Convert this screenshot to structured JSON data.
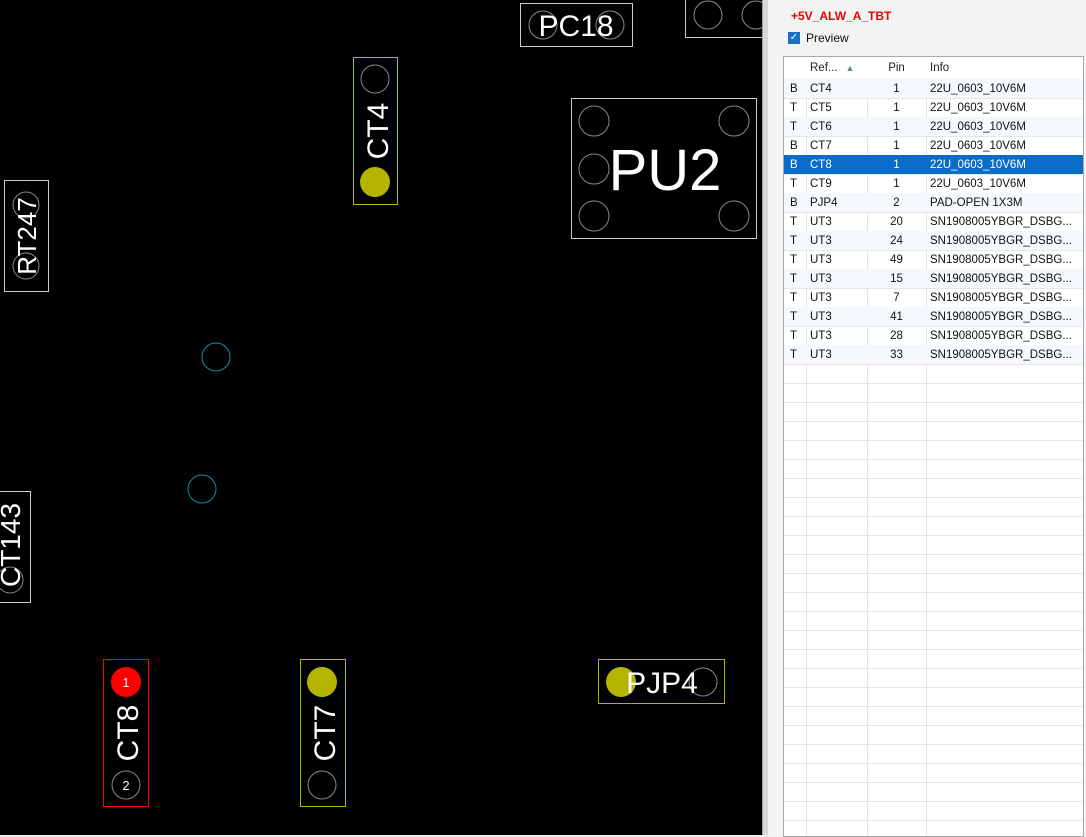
{
  "pcb": {
    "labels": {
      "pc18": "PC18",
      "ct4": "CT4",
      "pu2": "PU2",
      "rt247": "RT247",
      "ct143": "CT143",
      "ct8": "CT8",
      "ct7": "CT7",
      "pjp4": "PJP4"
    },
    "pin1": "1",
    "pin2": "2",
    "colors": {
      "highlight": "#ff0000",
      "pad": "#b5b500",
      "outline": "#cccccc",
      "via": "#1a8a9a"
    }
  },
  "panel": {
    "net_name": "+5V_ALW_A_TBT",
    "preview_label": "Preview",
    "preview_checked": true,
    "columns": {
      "side": "",
      "ref": "Ref...",
      "pin": "Pin",
      "info": "Info"
    },
    "rows": [
      {
        "side": "B",
        "ref": "CT4",
        "pin": "1",
        "info": "22U_0603_10V6M"
      },
      {
        "side": "T",
        "ref": "CT5",
        "pin": "1",
        "info": "22U_0603_10V6M"
      },
      {
        "side": "T",
        "ref": "CT6",
        "pin": "1",
        "info": "22U_0603_10V6M"
      },
      {
        "side": "B",
        "ref": "CT7",
        "pin": "1",
        "info": "22U_0603_10V6M"
      },
      {
        "side": "B",
        "ref": "CT8",
        "pin": "1",
        "info": "22U_0603_10V6M",
        "selected": true
      },
      {
        "side": "T",
        "ref": "CT9",
        "pin": "1",
        "info": "22U_0603_10V6M"
      },
      {
        "side": "B",
        "ref": "PJP4",
        "pin": "2",
        "info": "PAD-OPEN 1X3M"
      },
      {
        "side": "T",
        "ref": "UT3",
        "pin": "20",
        "info": "SN1908005YBGR_DSBG..."
      },
      {
        "side": "T",
        "ref": "UT3",
        "pin": "24",
        "info": "SN1908005YBGR_DSBG..."
      },
      {
        "side": "T",
        "ref": "UT3",
        "pin": "49",
        "info": "SN1908005YBGR_DSBG..."
      },
      {
        "side": "T",
        "ref": "UT3",
        "pin": "15",
        "info": "SN1908005YBGR_DSBG..."
      },
      {
        "side": "T",
        "ref": "UT3",
        "pin": "7",
        "info": "SN1908005YBGR_DSBG..."
      },
      {
        "side": "T",
        "ref": "UT3",
        "pin": "41",
        "info": "SN1908005YBGR_DSBG..."
      },
      {
        "side": "T",
        "ref": "UT3",
        "pin": "28",
        "info": "SN1908005YBGR_DSBG..."
      },
      {
        "side": "T",
        "ref": "UT3",
        "pin": "33",
        "info": "SN1908005YBGR_DSBG..."
      }
    ]
  }
}
